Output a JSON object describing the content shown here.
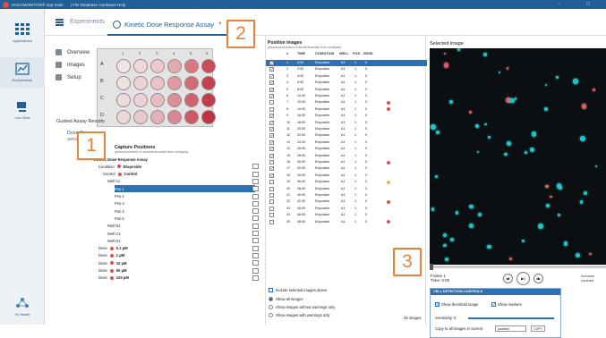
{
  "titlebar": {
    "app": "HOLOMONITOR® App Suite",
    "menu": "|   File   Database   Hardware   Help",
    "controls": "–  ▢"
  },
  "nav": [
    {
      "label": "Applications"
    },
    {
      "label": "Experiments"
    },
    {
      "label": "Live View"
    },
    {
      "label": "Hi-Health"
    }
  ],
  "header": {
    "tab_experiments": "Experiments",
    "tab_active": "Kinetic Dose Response Assay",
    "close": "×"
  },
  "badges": [
    "1",
    "2",
    "3"
  ],
  "side": {
    "overview": "Overview",
    "images": "Images",
    "setup": "Setup",
    "guided": "Guided Assay Results",
    "dose": "Dose Response",
    "dose_date": "19/04/25 13:15"
  },
  "plate": {
    "cols": [
      "1",
      "2",
      "3",
      "4",
      "5",
      "6"
    ],
    "rows": [
      "A",
      "B",
      "C",
      "D"
    ]
  },
  "capture": {
    "title": "Capture Positions",
    "subtitle": "(check/uncheck to include/exclude from analysis)",
    "tree": [
      {
        "label": "Kinetic Dose Response Assay",
        "bold": true
      },
      {
        "label": "Condition",
        "dot": "#d9534f",
        "tail": "Etoposide"
      },
      {
        "label": "Control",
        "dot": "#d9534f",
        "tail": "Control"
      },
      {
        "label": "Well A1"
      },
      {
        "label": "Pos 1",
        "sel": true
      },
      {
        "label": "Pos 2"
      },
      {
        "label": "Pos 3"
      },
      {
        "label": "Pos 4"
      },
      {
        "label": "Pos 5"
      },
      {
        "label": "Well B1"
      },
      {
        "label": "Well C1"
      },
      {
        "label": "Well D1"
      },
      {
        "label": "Dose",
        "dot": "#d9534f",
        "tail": "0.1 µM"
      },
      {
        "label": "Dose",
        "dot": "#d9534f",
        "tail": "1 µM"
      },
      {
        "label": "Dose",
        "dot": "#d9534f",
        "tail": "10 µM"
      },
      {
        "label": "Dose",
        "dot": "#d9534f",
        "tail": "50 µM"
      },
      {
        "label": "Dose",
        "dot": "#d9534f",
        "tail": "100 µM"
      }
    ]
  },
  "positions": {
    "title": "Position images",
    "subtitle": "(check/uncheck to include/exclude from analysis)",
    "headers": [
      "#",
      "TIME",
      "CONDITION",
      "WELL",
      "POS.",
      "SENS."
    ],
    "rows": [
      [
        "1",
        "0:00",
        "Etoposide",
        "A1",
        "1",
        "0",
        "",
        true
      ],
      [
        "2",
        "2:00",
        "Etoposide",
        "A1",
        "1",
        "0",
        "",
        true
      ],
      [
        "3",
        "4:00",
        "Etoposide",
        "A1",
        "1",
        "0",
        "",
        true
      ],
      [
        "4",
        "6:00",
        "Etoposide",
        "A1",
        "1",
        "0",
        "",
        true
      ],
      [
        "5",
        "8:00",
        "Etoposide",
        "A1",
        "1",
        "0",
        "",
        true
      ],
      [
        "6",
        "10:00",
        "Etoposide",
        "A1",
        "1",
        "0",
        "",
        true
      ],
      [
        "7",
        "12:00",
        "Etoposide",
        "A1",
        "1",
        "0",
        "#d9534f",
        false
      ],
      [
        "8",
        "14:00",
        "Etoposide",
        "A1",
        "1",
        "0",
        "#d9534f",
        false
      ],
      [
        "9",
        "16:00",
        "Etoposide",
        "A1",
        "1",
        "0",
        "",
        true
      ],
      [
        "10",
        "18:00",
        "Etoposide",
        "A1",
        "1",
        "0",
        "",
        true
      ],
      [
        "11",
        "20:00",
        "Etoposide",
        "A1",
        "1",
        "0",
        "",
        true
      ],
      [
        "12",
        "22:00",
        "Etoposide",
        "A1",
        "1",
        "0",
        "",
        true
      ],
      [
        "13",
        "24:00",
        "Etoposide",
        "A1",
        "1",
        "0",
        "",
        true
      ],
      [
        "14",
        "26:00",
        "Etoposide",
        "A1",
        "1",
        "0",
        "",
        true
      ],
      [
        "15",
        "28:00",
        "Etoposide",
        "A1",
        "1",
        "0",
        "",
        true
      ],
      [
        "16",
        "30:00",
        "Etoposide",
        "A1",
        "1",
        "0",
        "#d9534f",
        false
      ],
      [
        "17",
        "32:00",
        "Etoposide",
        "A1",
        "1",
        "0",
        "",
        true
      ],
      [
        "18",
        "34:00",
        "Etoposide",
        "A1",
        "1",
        "0",
        "",
        true
      ],
      [
        "19",
        "36:00",
        "Etoposide",
        "A1",
        "1",
        "0",
        "#f0ad4e",
        false
      ],
      [
        "20",
        "38:00",
        "Etoposide",
        "A1",
        "1",
        "0",
        "",
        false
      ],
      [
        "21",
        "40:00",
        "Etoposide",
        "A1",
        "1",
        "0",
        "",
        false
      ],
      [
        "22",
        "42:00",
        "Etoposide",
        "A1",
        "1",
        "0",
        "#d9534f",
        false
      ],
      [
        "23",
        "44:00",
        "Etoposide",
        "A1",
        "1",
        "0",
        "",
        false
      ],
      [
        "24",
        "46:00",
        "Etoposide",
        "A1",
        "1",
        "0",
        "",
        false
      ],
      [
        "25",
        "48:00",
        "Etoposide",
        "A1",
        "1",
        "0",
        "#d9534f",
        false
      ]
    ],
    "opt_include": "Include selected images above",
    "opt_all": "Show all images",
    "opt_nowarn": "Show images without warnings only",
    "opt_warn": "Show images with warnings only",
    "count": "25 images"
  },
  "viewer": {
    "title": "Selected image",
    "frame": "Frame 1",
    "time": "Time: 0:00",
    "increase": "Increase contrast"
  },
  "cdc": {
    "title": "CELL DETECTION CONTROLS",
    "thresh": "Show threshold image",
    "markers": "Show markers",
    "sens": "Sensitivity: 0",
    "copy_label": "Copy to all images in current",
    "copy_sel": "position",
    "copy_btn": "COPY"
  }
}
